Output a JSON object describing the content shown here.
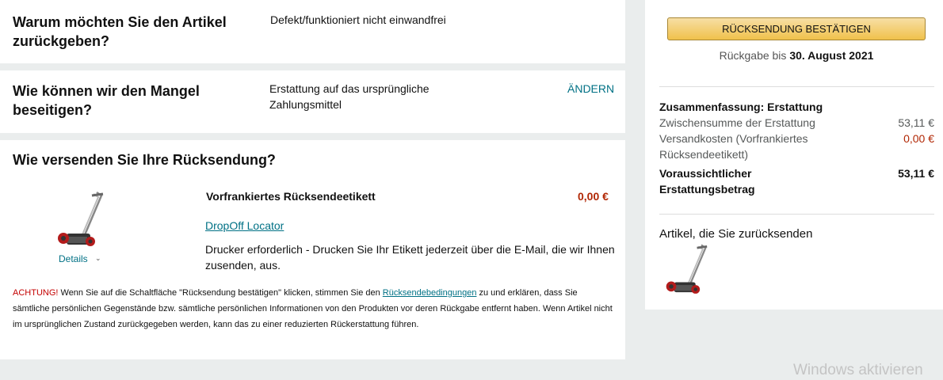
{
  "reason": {
    "question": "Warum möchten Sie den Artikel zurückgeben?",
    "answer": "Defekt/funktioniert nicht einwandfrei"
  },
  "resolution": {
    "question": "Wie können wir den Mangel beseitigen?",
    "answer": "Erstattung auf das ursprüngliche Zahlungsmittel",
    "change_label": "ÄNDERN"
  },
  "shipping": {
    "question": "Wie versenden Sie Ihre Rücksendung?",
    "option_title": "Vorfrankiertes Rücksendeetikett",
    "option_price": "0,00 €",
    "locator_link": "DropOff Locator",
    "printer_note": "Drucker erforderlich - Drucken Sie Ihr Etikett jederzeit über die E-Mail, die wir Ihnen zusenden, aus.",
    "details_label": "Details"
  },
  "warning": {
    "prefix": "ACHTUNG!",
    "text_before": " Wenn Sie auf die Schaltfläche \"Rücksendung bestätigen\" klicken, stimmen Sie den ",
    "terms_link": "Rücksendebedingungen",
    "text_after": " zu und erklären, dass Sie sämtliche persönlichen Gegenstände bzw. sämtliche persönlichen Informationen von den Produkten vor deren Rückgabe entfernt haben. Wenn Artikel nicht im ursprünglichen Zustand zurückgegeben werden, kann das zu einer reduzierten Rückerstattung führen."
  },
  "sidebar": {
    "confirm_button": "RÜCKSENDUNG BESTÄTIGEN",
    "return_by_prefix": "Rückgabe bis ",
    "return_by_date": "30. August 2021",
    "summary_title": "Zusammenfassung: Erstattung",
    "subtotal_label": "Zwischensumme der Erstattung",
    "subtotal_value": "53,11 €",
    "shipping_label": "Versandkosten (Vorfrankiertes Rücksendeetikett)",
    "shipping_value": "0,00 €",
    "total_label": "Voraussichtlicher Erstattungsbetrag",
    "total_value": "53,11 €",
    "items_title": "Artikel, die Sie zurücksenden"
  },
  "watermark": "Windows aktivieren",
  "colors": {
    "accent_teal": "#007185",
    "price_red": "#b12704",
    "button_yellow": "#f0c14b",
    "background": "#eaeded"
  }
}
